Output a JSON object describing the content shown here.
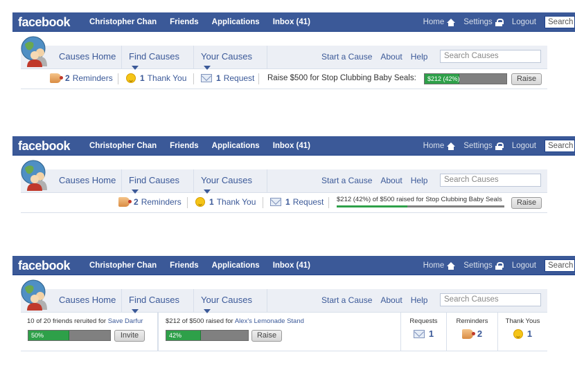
{
  "fb": {
    "logo": "facebook",
    "nav": [
      "Christopher Chan",
      "Friends",
      "Applications",
      "Inbox (41)"
    ],
    "home": "Home",
    "settings": "Settings",
    "logout": "Logout",
    "search_placeholder": "Search"
  },
  "causes": {
    "home": "Causes Home",
    "find": "Find Causes",
    "your": "Your Causes",
    "start": "Start a Cause",
    "about": "About",
    "help": "Help",
    "search_placeholder": "Search Causes"
  },
  "v1": {
    "reminders_count": "2",
    "reminders_label": "Reminders",
    "thanks_count": "1",
    "thanks_label": "Thank You",
    "request_count": "1",
    "request_label": "Request",
    "raise_text": "Raise $500 for Stop Clubbing Baby Seals:",
    "progress_text": "$212 (42%)",
    "progress_fraction": 0.42,
    "raise_button": "Raise"
  },
  "v2": {
    "reminders_count": "2",
    "reminders_label": "Reminders",
    "thanks_count": "1",
    "thanks_label": "Thank You",
    "request_count": "1",
    "request_label": "Request",
    "progress_text": "$212 (42%) of $500 raised for Stop Clubbing Baby Seals",
    "progress_fraction": 0.42,
    "raise_button": "Raise"
  },
  "v3": {
    "recruit_text": "10 of 20 friends reruited for",
    "recruit_cause": "Save Darfur",
    "recruit_pct": "50%",
    "recruit_fraction": 0.5,
    "invite_button": "Invite",
    "raise_text": "$212 of $500 raised for",
    "raise_cause": "Alex's Lemonade Stand",
    "raise_pct": "42%",
    "raise_fraction": 0.42,
    "raise_button": "Raise",
    "requests_label": "Requests",
    "requests_count": "1",
    "reminders_label": "Reminders",
    "reminders_count": "2",
    "thanks_label": "Thank Yous",
    "thanks_count": "1"
  }
}
